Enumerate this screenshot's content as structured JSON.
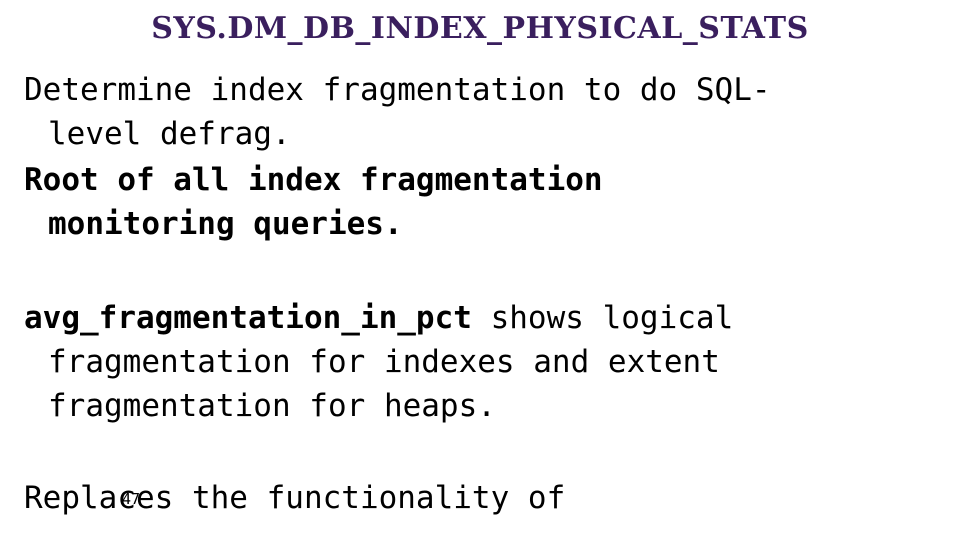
{
  "slide": {
    "title": "SYS.DM_DB_INDEX_PHYSICAL_STATS",
    "title_color": "#3a1f5e",
    "background_color": "#ffffff",
    "page_number": "47",
    "bullets": [
      {
        "id": "bullet-determine-index-fragmentation",
        "weight": "normal",
        "line1": "Determine index fragmentation to do SQL-",
        "line2": "level defrag."
      },
      {
        "id": "bullet-root-of-all-monitoring",
        "weight": "bold",
        "line1": "Root of all index fragmentation",
        "line2": "monitoring queries."
      },
      {
        "id": "bullet-avg-fragmentation-in-pct",
        "weight": "normal",
        "code_token": "avg_fragmentation_in_pct",
        "line1_rest": " shows logical",
        "line2": "fragmentation for indexes and extent",
        "line3": "fragmentation for heaps."
      },
      {
        "id": "bullet-replaces-functionality",
        "weight": "normal",
        "line1": "Replaces the functionality of"
      }
    ]
  }
}
